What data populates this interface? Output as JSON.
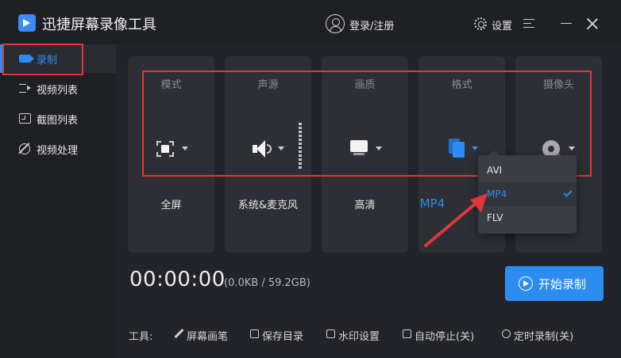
{
  "titlebar": {
    "app_title": "迅捷屏幕录像工具",
    "login_label": "登录/注册",
    "settings_label": "设置",
    "icons": [
      "app-logo-icon",
      "user-icon",
      "gear-icon",
      "menu-icon",
      "minimize-icon",
      "close-icon"
    ]
  },
  "sidebar": {
    "items": [
      {
        "label": "录制",
        "icon": "video-camera-icon",
        "active": true
      },
      {
        "label": "视频列表",
        "icon": "video-list-icon",
        "active": false
      },
      {
        "label": "截图列表",
        "icon": "screenshot-list-icon",
        "active": false
      },
      {
        "label": "视频处理",
        "icon": "video-tools-icon",
        "active": false
      }
    ]
  },
  "cards": [
    {
      "title": "模式",
      "value": "全屏",
      "icon": "fullscreen-icon"
    },
    {
      "title": "声源",
      "value": "系统&麦克风",
      "icon": "speaker-icon"
    },
    {
      "title": "画质",
      "value": "高清",
      "icon": "monitor-icon"
    },
    {
      "title": "格式",
      "value": "MP4",
      "icon": "file-icon"
    },
    {
      "title": "摄像头",
      "value": "",
      "icon": "webcam-icon"
    }
  ],
  "format_menu": {
    "options": [
      "AVI",
      "MP4",
      "FLV"
    ],
    "selected": "MP4"
  },
  "timer": "00:00:00",
  "file_size": "(0.0KB / 59.2GB)",
  "record_button": "开始录制",
  "tools": {
    "label": "工具:",
    "items": [
      "屏幕画笔",
      "保存目录",
      "水印设置",
      "自动停止(关)",
      "定时录制(关)"
    ]
  },
  "colors": {
    "accent": "#2d8cf0",
    "background": "#232429",
    "card": "#2d2f35",
    "highlight": "#e0373a"
  }
}
